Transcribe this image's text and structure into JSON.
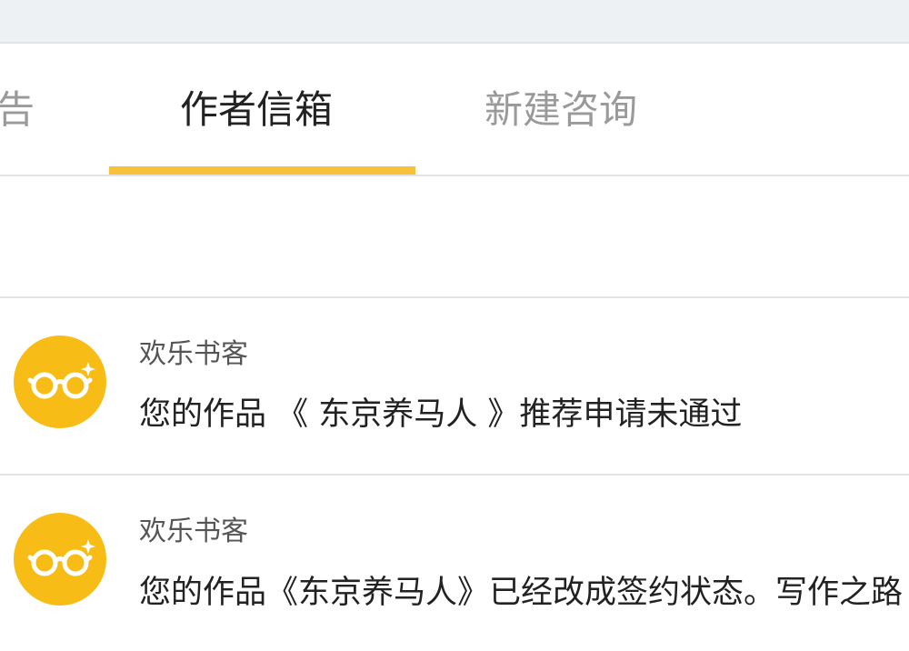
{
  "tabs": [
    {
      "label": "告",
      "active": false
    },
    {
      "label": "作者信箱",
      "active": true
    },
    {
      "label": "新建咨询",
      "active": false
    }
  ],
  "colors": {
    "accent": "#f7c13a",
    "avatar": "#f7bd16",
    "inactive_tab": "#9a9a9a",
    "active_tab": "#222222"
  },
  "messages": [
    {
      "sender": "欢乐书客",
      "avatar_icon": "glasses-icon",
      "text": "您的作品 《 东京养马人 》推荐申请未通过"
    },
    {
      "sender": "欢乐书客",
      "avatar_icon": "glasses-icon",
      "text": "您的作品《东京养马人》已经改成签约状态。写作之路"
    }
  ]
}
